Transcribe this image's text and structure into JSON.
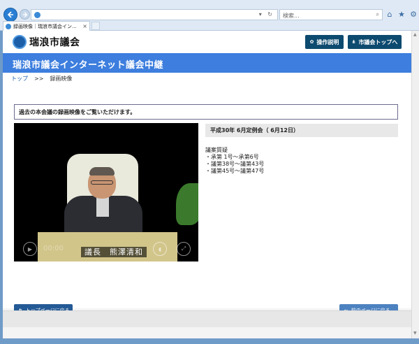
{
  "browser": {
    "search_placeholder": "検索...",
    "tab_title": "録画映像｜瑞浪市議会イン...",
    "tab_close": "×",
    "address_tools": "▾ ↻",
    "search_icon": "search-icon",
    "right_icons": [
      "home-icon",
      "star-icon",
      "gear-icon"
    ]
  },
  "header": {
    "logo_text": "瑞浪市議会",
    "guide_button": "操作説明",
    "assembly_top_button": "市議会トップへ"
  },
  "banner": {
    "title": "瑞浪市議会インターネット議会中継",
    "color": "#3d7ede"
  },
  "breadcrumb": {
    "top": "トップ",
    "separator": ">>",
    "current": "録画映像"
  },
  "notice": "過去の本会議の録画映像をご覧いただけます。",
  "video": {
    "time": "00:00",
    "caption": "議長　熊澤清和"
  },
  "session": {
    "title": "平成30年 6月定例会（ 6月12日）",
    "agenda_heading": "議案質疑",
    "agenda_items": [
      "・承第 1号～承第6号",
      "・議第38号～議第43号",
      "・議第45号～議第47号"
    ]
  },
  "footer_buttons": {
    "top_page": "トップページに戻る",
    "prev_page": "前のページに戻る"
  },
  "colors": {
    "header_button": "#0d4a6f",
    "footer_button": "#245a95",
    "link": "#1b5ea8"
  }
}
